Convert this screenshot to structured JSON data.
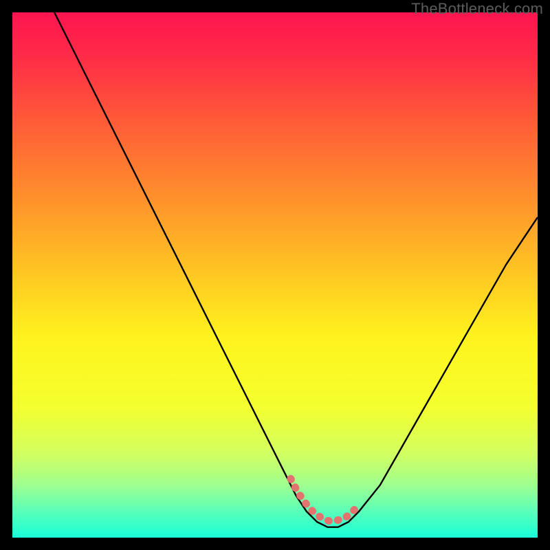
{
  "watermark": "TheBottleneck.com",
  "colors": {
    "frame": "#000000",
    "curve": "#000000",
    "accent_pink": "#e3736f",
    "gradient_stops": [
      {
        "offset": 0.0,
        "color": "#ff1450"
      },
      {
        "offset": 0.08,
        "color": "#ff2a48"
      },
      {
        "offset": 0.2,
        "color": "#ff5838"
      },
      {
        "offset": 0.35,
        "color": "#ff8f2c"
      },
      {
        "offset": 0.5,
        "color": "#ffc822"
      },
      {
        "offset": 0.62,
        "color": "#fff31e"
      },
      {
        "offset": 0.75,
        "color": "#f4ff2e"
      },
      {
        "offset": 0.84,
        "color": "#d2ff60"
      },
      {
        "offset": 0.9,
        "color": "#9fff90"
      },
      {
        "offset": 0.95,
        "color": "#5affb8"
      },
      {
        "offset": 1.0,
        "color": "#18ffda"
      }
    ]
  },
  "chart_data": {
    "type": "line",
    "title": "",
    "xlabel": "",
    "ylabel": "",
    "xlim": [
      0,
      100
    ],
    "ylim": [
      0,
      100
    ],
    "series": [
      {
        "name": "bottleneck-curve",
        "x": [
          8,
          12,
          16,
          20,
          24,
          28,
          32,
          36,
          40,
          44,
          48,
          52,
          54,
          56,
          58,
          60,
          62,
          64,
          66,
          70,
          74,
          78,
          82,
          86,
          90,
          94,
          98,
          100
        ],
        "y": [
          100,
          92,
          84,
          76,
          68,
          60,
          52,
          44,
          36,
          28,
          20,
          12,
          8,
          5,
          3,
          2,
          2,
          3,
          5,
          10,
          17,
          24,
          31,
          38,
          45,
          52,
          58,
          61
        ]
      }
    ],
    "annotations": [
      {
        "name": "valley-accent",
        "x_range": [
          53,
          67
        ],
        "note": "pink dotted arc highlighting the curve minimum"
      }
    ]
  }
}
